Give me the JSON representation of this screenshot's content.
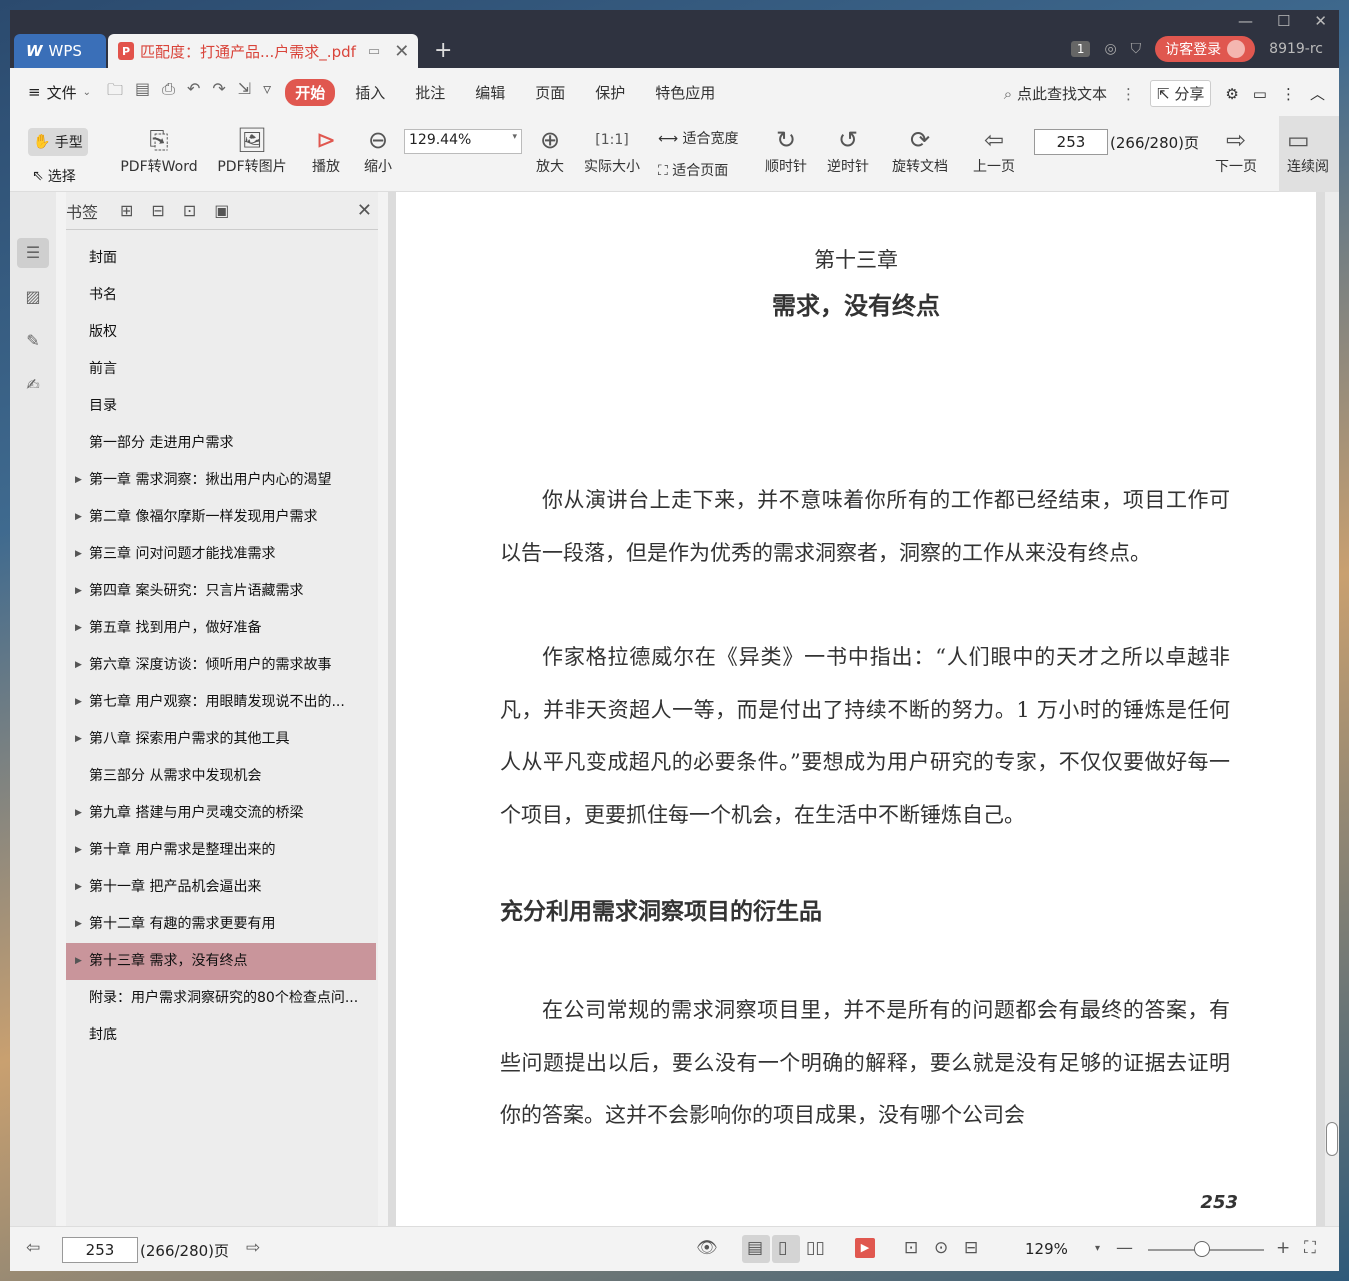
{
  "titlebar": {
    "wps_label": "WPS",
    "doc_tab_title": "匹配度：打通产品...户需求_.pdf",
    "badge_number": "1",
    "login_label": "访客登录",
    "user_id": "8919-rc"
  },
  "menubar": {
    "file_label": "文件",
    "tabs": [
      "开始",
      "插入",
      "批注",
      "编辑",
      "页面",
      "保护",
      "特色应用"
    ],
    "search_label": "点此查找文本",
    "share_label": "分享"
  },
  "toolbar": {
    "hand_label": "手型",
    "select_label": "选择",
    "pdf_to_word": "PDF转Word",
    "pdf_to_image": "PDF转图片",
    "play": "播放",
    "zoom_out": "缩小",
    "zoom_value": "129.44%",
    "zoom_in": "放大",
    "actual_size": "实际大小",
    "fit_width": "适合宽度",
    "fit_page": "适合页面",
    "rotate_cw": "顺时针",
    "rotate_ccw": "逆时针",
    "rotate_doc": "旋转文档",
    "prev_page": "上一页",
    "page_value": "253",
    "page_total": "(266/280)页",
    "next_page": "下一页",
    "continuous": "连续阅"
  },
  "bookmarks": {
    "title": "书签",
    "items": [
      {
        "label": "封面",
        "expandable": false
      },
      {
        "label": "书名",
        "expandable": false
      },
      {
        "label": "版权",
        "expandable": false
      },
      {
        "label": "前言",
        "expandable": false
      },
      {
        "label": "目录",
        "expandable": false
      },
      {
        "label": "第一部分  走进用户需求",
        "expandable": false
      },
      {
        "label": "第一章  需求洞察：揪出用户内心的渴望",
        "expandable": true
      },
      {
        "label": "第二章  像福尔摩斯一样发现用户需求",
        "expandable": true
      },
      {
        "label": "第三章  问对问题才能找准需求",
        "expandable": true
      },
      {
        "label": "第四章  案头研究：只言片语藏需求",
        "expandable": true
      },
      {
        "label": "第五章  找到用户，做好准备",
        "expandable": true
      },
      {
        "label": "第六章  深度访谈：倾听用户的需求故事",
        "expandable": true
      },
      {
        "label": "第七章  用户观察：用眼睛发现说不出的...",
        "expandable": true
      },
      {
        "label": "第八章  探索用户需求的其他工具",
        "expandable": true
      },
      {
        "label": "第三部分  从需求中发现机会",
        "expandable": false
      },
      {
        "label": "第九章  搭建与用户灵魂交流的桥梁",
        "expandable": true
      },
      {
        "label": "第十章  用户需求是整理出来的",
        "expandable": true
      },
      {
        "label": "第十一章  把产品机会逼出来",
        "expandable": true
      },
      {
        "label": "第十二章  有趣的需求更要有用",
        "expandable": true
      },
      {
        "label": "第十三章  需求，没有终点",
        "expandable": true,
        "selected": true
      },
      {
        "label": "附录：用户需求洞察研究的80个检查点问...",
        "expandable": false
      },
      {
        "label": "封底",
        "expandable": false
      }
    ]
  },
  "document": {
    "chapter_number": "第十三章",
    "chapter_title": "需求，没有终点",
    "para1": "你从演讲台上走下来，并不意味着你所有的工作都已经结束，项目工作可以告一段落，但是作为优秀的需求洞察者，洞察的工作从来没有终点。",
    "para2": "作家格拉德威尔在《异类》一书中指出：“人们眼中的天才之所以卓越非凡，并非天资超人一等，而是付出了持续不断的努力。1 万小时的锤炼是任何人从平凡变成超凡的必要条件。”要想成为用户研究的专家，不仅仅要做好每一个项目，更要抓住每一个机会，在生活中不断锤炼自己。",
    "section_heading": "充分利用需求洞察项目的衍生品",
    "para3": "在公司常规的需求洞察项目里，并不是所有的问题都会有最终的答案，有些问题提出以后，要么没有一个明确的解释，要么就是没有足够的证据去证明你的答案。这并不会影响你的项目成果，没有哪个公司会",
    "page_number": "253"
  },
  "statusbar": {
    "page_value": "253",
    "page_total": "(266/280)页",
    "zoom_label": "129%"
  }
}
